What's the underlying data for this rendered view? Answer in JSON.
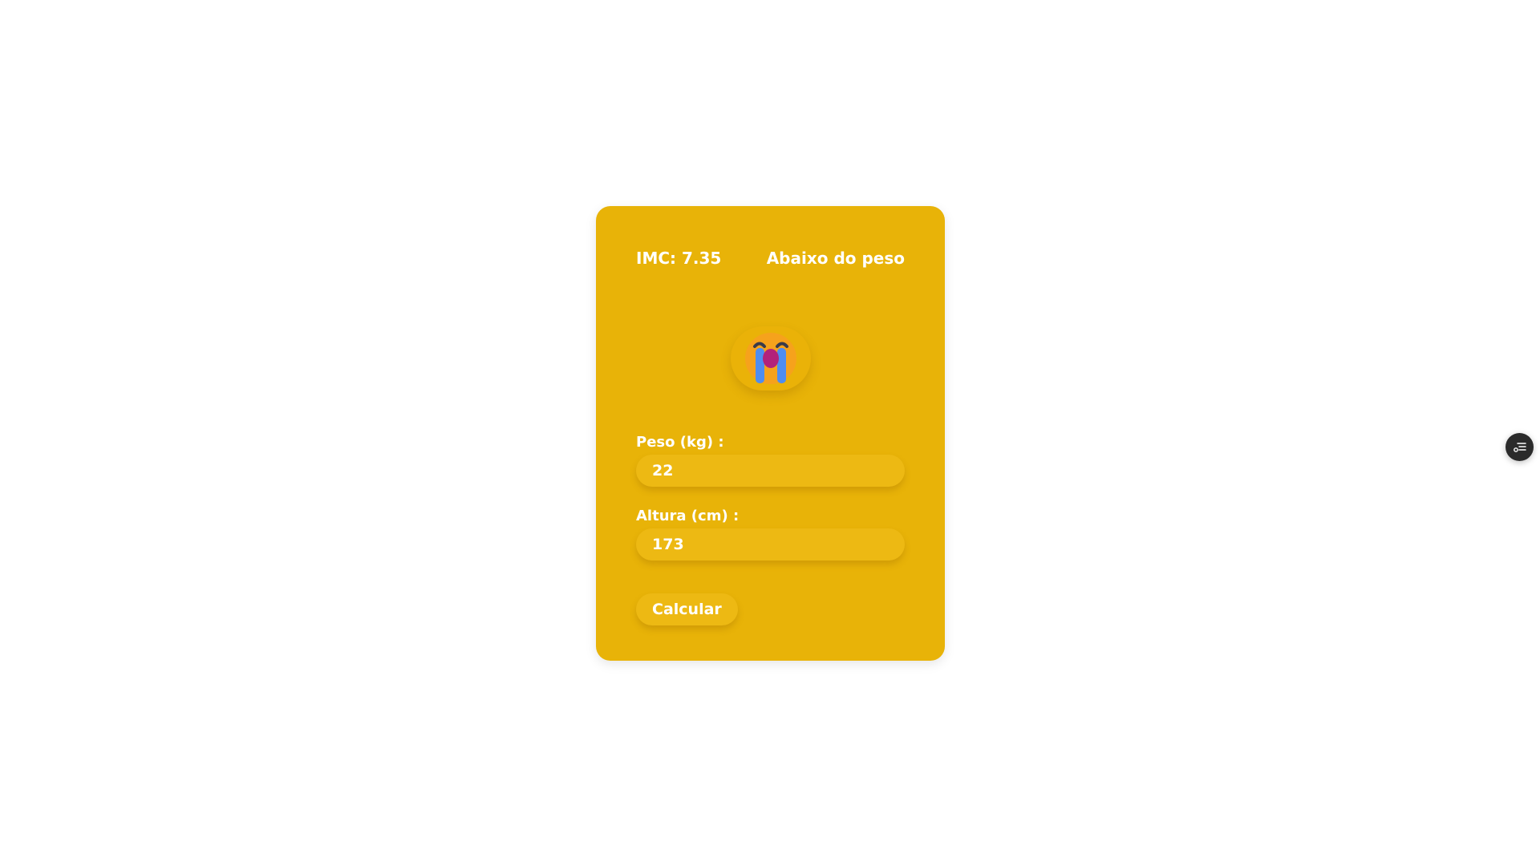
{
  "result": {
    "imc_text": "IMC: 7.35",
    "category": "Abaixo do peso"
  },
  "emoji": {
    "icon": "crying-face-icon"
  },
  "form": {
    "weight_label": "Peso (kg) :",
    "weight_value": "22",
    "height_label": "Altura (cm) :",
    "height_value": "173",
    "submit_label": "Calcular"
  },
  "floating_button": {
    "icon": "list-settings-icon"
  },
  "colors": {
    "card_background": "#e8b308",
    "input_background": "#edb913",
    "text": "#ffffff",
    "floating_button": "#2b2b2b"
  }
}
